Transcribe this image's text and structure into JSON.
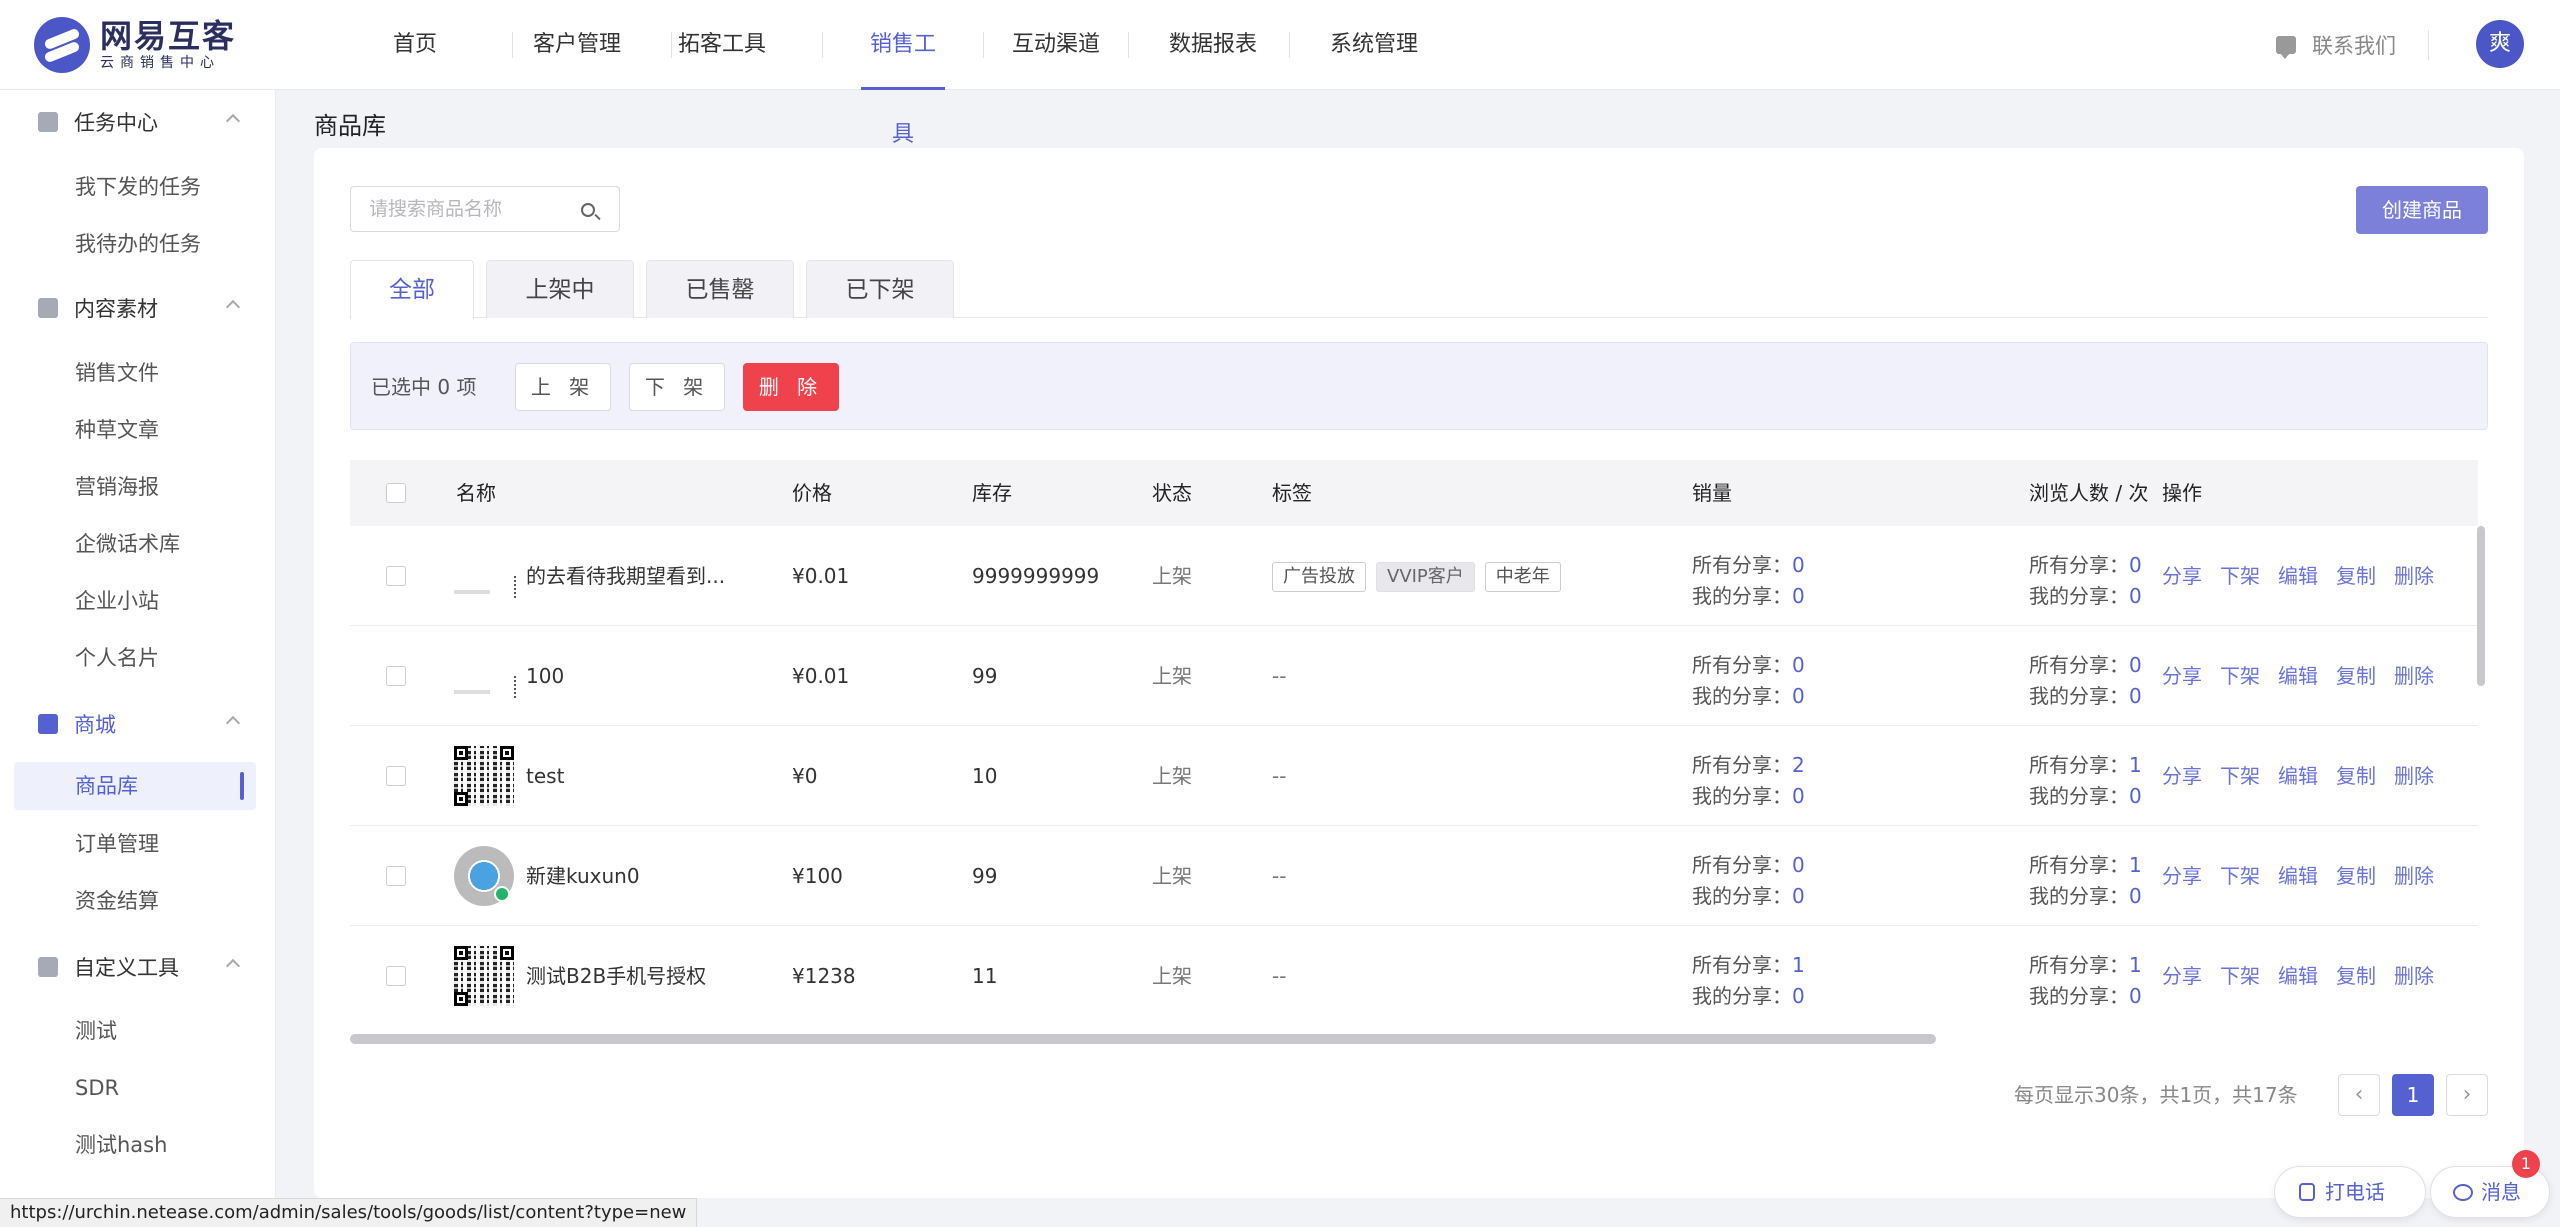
{
  "brand": {
    "title": "网易互客",
    "subtitle": "云商销售中心"
  },
  "nav": {
    "items": [
      "首页",
      "客户管理",
      "拓客工具",
      "销售工具",
      "互动渠道",
      "数据报表",
      "系统管理"
    ],
    "active": "销售工具"
  },
  "header": {
    "contact": "联系我们",
    "avatar": "爽"
  },
  "sidebar": {
    "groups": [
      {
        "label": "任务中心",
        "items": [
          "我下发的任务",
          "我待办的任务"
        ]
      },
      {
        "label": "内容素材",
        "items": [
          "销售文件",
          "种草文章",
          "营销海报",
          "企微话术库",
          "企业小站",
          "个人名片"
        ]
      },
      {
        "label": "商城",
        "items": [
          "商品库",
          "订单管理",
          "资金结算"
        ]
      },
      {
        "label": "自定义工具",
        "items": [
          "测试",
          "SDR",
          "测试hash"
        ]
      }
    ],
    "active_item": "商品库"
  },
  "page": {
    "title": "商品库"
  },
  "search": {
    "placeholder": "请搜索商品名称",
    "value": ""
  },
  "create_button": "创建商品",
  "tabs": {
    "items": [
      "全部",
      "上架中",
      "已售罄",
      "已下架"
    ],
    "active": "全部"
  },
  "bulk": {
    "selected_text": "已选中 0 项",
    "on_shelf": "上 架",
    "off_shelf": "下 架",
    "delete": "删 除"
  },
  "table": {
    "headers": {
      "name": "名称",
      "price": "价格",
      "stock": "库存",
      "status": "状态",
      "tags": "标签",
      "sales": "销量",
      "views": "浏览人数 / 次",
      "ops": "操作"
    },
    "share_labels": {
      "all": "所有分享：",
      "mine": "我的分享："
    },
    "op_labels": [
      "分享",
      "下架",
      "编辑",
      "复制",
      "删除"
    ],
    "rows": [
      {
        "thumb": "blank",
        "name": "的去看待我期望看到...",
        "price": "¥0.01",
        "stock": "9999999999",
        "status": "上架",
        "tags": [
          "广告投放",
          "VVIP客户",
          "中老年"
        ],
        "sales_all": "0",
        "sales_mine": "0",
        "views_all": "0",
        "views_mine": "0"
      },
      {
        "thumb": "blank",
        "name": "100",
        "price": "¥0.01",
        "stock": "99",
        "status": "上架",
        "tags": [],
        "tags_empty": "--",
        "sales_all": "0",
        "sales_mine": "0",
        "views_all": "0",
        "views_mine": "0"
      },
      {
        "thumb": "qr",
        "name": "test",
        "price": "¥0",
        "stock": "10",
        "status": "上架",
        "tags": [],
        "tags_empty": "--",
        "sales_all": "2",
        "sales_mine": "0",
        "views_all": "1",
        "views_mine": "0"
      },
      {
        "thumb": "circle",
        "name": "新建kuxun0",
        "price": "¥100",
        "stock": "99",
        "status": "上架",
        "tags": [],
        "tags_empty": "--",
        "sales_all": "0",
        "sales_mine": "0",
        "views_all": "1",
        "views_mine": "0"
      },
      {
        "thumb": "qr",
        "name": "测试B2B手机号授权",
        "price": "¥1238",
        "stock": "11",
        "status": "上架",
        "tags": [],
        "tags_empty": "--",
        "sales_all": "1",
        "sales_mine": "0",
        "views_all": "1",
        "views_mine": "0"
      }
    ]
  },
  "pagination": {
    "summary": "每页显示30条，共1页，共17条",
    "current": "1",
    "prev": "‹",
    "next": "›"
  },
  "status_url": "https://urchin.netease.com/admin/sales/tools/goods/list/content?type=new",
  "floating": {
    "call": "打电话",
    "message": "消息",
    "badge": "1"
  }
}
